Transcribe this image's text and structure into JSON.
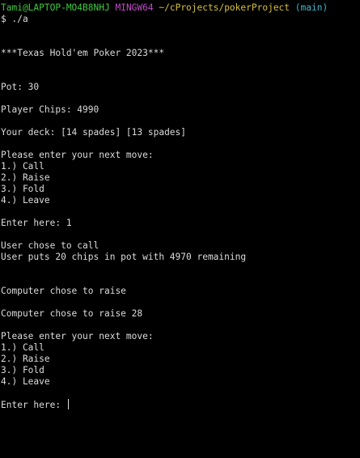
{
  "prompt": {
    "user_host": "Tami@LAPTOP-MO4B8NHJ",
    "shell": "MINGW64",
    "cwd": "~/cProjects/pokerProject",
    "branch": "(main)",
    "command": "$ ./a"
  },
  "output": {
    "title": "***Texas Hold'em Poker 2023***",
    "pot": "Pot: 30",
    "player_chips": "Player Chips: 4990",
    "deck": "Your deck: [14 spades] [13 spades]",
    "menu1": {
      "prompt": "Please enter your next move:",
      "options": [
        "1.) Call",
        "2.) Raise",
        "3.) Fold",
        "4.) Leave"
      ]
    },
    "entry1": "Enter here: 1",
    "user_choice": "User chose to call",
    "user_chips": "User puts 20 chips in pot with 4970 remaining",
    "computer_choice": "Computer chose to raise",
    "computer_raise": "Computer chose to raise 28",
    "menu2": {
      "prompt": "Please enter your next move:",
      "options": [
        "1.) Call",
        "2.) Raise",
        "3.) Fold",
        "4.) Leave"
      ]
    },
    "entry2": "Enter here: "
  },
  "colors": {
    "user_host": "#3ec93e",
    "shell": "#c14bc6",
    "cwd": "#d6c23a",
    "branch": "#3fb8c9",
    "text": "#dcdcdc",
    "background": "#000000"
  }
}
